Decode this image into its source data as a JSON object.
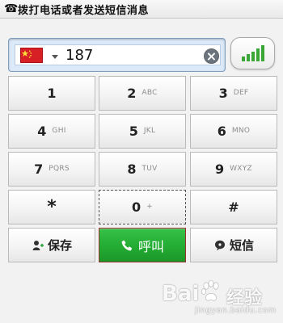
{
  "window": {
    "title": "拨打电话或者发送短信消息",
    "title_icon": "phone-icon"
  },
  "dialer": {
    "country_flag": "china-flag",
    "phone_number": "187",
    "clear_icon": "clear-icon",
    "signal_icon": "signal-bars-icon",
    "keys": [
      {
        "digit": "1",
        "letters": ""
      },
      {
        "digit": "2",
        "letters": "ABC"
      },
      {
        "digit": "3",
        "letters": "DEF"
      },
      {
        "digit": "4",
        "letters": "GHI"
      },
      {
        "digit": "5",
        "letters": "JKL"
      },
      {
        "digit": "6",
        "letters": "MNO"
      },
      {
        "digit": "7",
        "letters": "PQRS"
      },
      {
        "digit": "8",
        "letters": "TUV"
      },
      {
        "digit": "9",
        "letters": "WXYZ"
      },
      {
        "digit": "*",
        "letters": ""
      },
      {
        "digit": "0",
        "letters": "+"
      },
      {
        "digit": "#",
        "letters": ""
      }
    ],
    "actions": {
      "save_label": "保存",
      "save_icon": "add-contact-icon",
      "call_label": "呼叫",
      "call_icon": "phone-call-icon",
      "sms_label": "短信",
      "sms_icon": "message-icon"
    }
  },
  "watermark": {
    "brand_left": "Bai",
    "brand_right": "经验",
    "domain": "jingyan.baidu.com"
  },
  "colors": {
    "call_green": "#24ad34",
    "flag_red": "#d71f26",
    "signal_green": "#3aa635"
  }
}
